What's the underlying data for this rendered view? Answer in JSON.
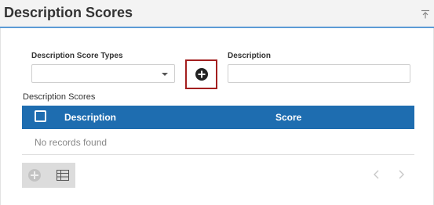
{
  "header": {
    "title": "Description Scores"
  },
  "form": {
    "types_label": "Description Score Types",
    "types_value": "",
    "description_label": "Description",
    "description_value": "",
    "description_placeholder": ""
  },
  "grid": {
    "section_label": "Description Scores",
    "columns": [
      "Description",
      "Score"
    ],
    "empty_message": "No records found"
  },
  "colors": {
    "header_accent": "#5b9bd5",
    "table_header": "#1e6db0",
    "add_button_border": "#a31f1f"
  }
}
